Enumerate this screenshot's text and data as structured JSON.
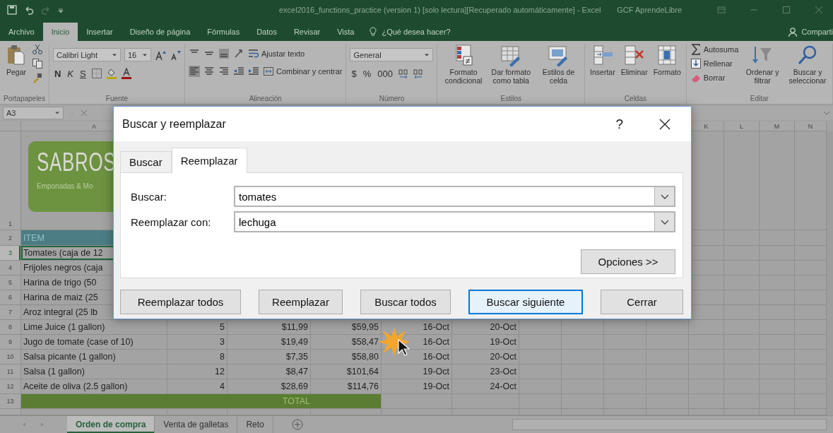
{
  "title_bar": {
    "title": "excel2016_functions_practice (version 1) [solo lectura][Recuperado automáticamente] - Excel",
    "user": "GCF AprendeLibre"
  },
  "menu_tabs": [
    {
      "label": "Archivo",
      "selected": false
    },
    {
      "label": "Inicio",
      "selected": true
    },
    {
      "label": "Insertar",
      "selected": false
    },
    {
      "label": "Diseño de página",
      "selected": false
    },
    {
      "label": "Fórmulas",
      "selected": false
    },
    {
      "label": "Datos",
      "selected": false
    },
    {
      "label": "Revisar",
      "selected": false
    },
    {
      "label": "Vista",
      "selected": false
    }
  ],
  "tell_me": "¿Qué desea hacer?",
  "share": "Comparti",
  "ribbon": [
    {
      "label": "Portapapeles",
      "kind": "columns",
      "lines": [
        [
          {
            "kind": "large",
            "text": "Pegar"
          }
        ],
        [
          {
            "kind": "icon"
          },
          {
            "kind": "icon"
          },
          {
            "kind": "icon"
          }
        ]
      ]
    },
    {
      "label": "Fuente",
      "kind": "rows",
      "lines": [
        [
          {
            "kind": "select",
            "text": "Calibri Light"
          },
          {
            "kind": "select",
            "text": "16"
          },
          {
            "kind": "icon"
          },
          {
            "kind": "icon"
          }
        ],
        [
          {
            "kind": "bold",
            "text": "N"
          },
          {
            "kind": "italic",
            "text": "K"
          },
          {
            "kind": "underline",
            "text": "S"
          },
          {
            "kind": "icon"
          },
          {
            "kind": "icon"
          },
          {
            "kind": "icon"
          }
        ]
      ]
    },
    {
      "label": "Alineación",
      "kind": "rows",
      "lines": [
        [
          {
            "kind": "icon"
          },
          {
            "kind": "icon"
          },
          {
            "kind": "icon"
          },
          {
            "kind": "icon"
          },
          {
            "kind": "small",
            "text": "Ajustar texto"
          }
        ],
        [
          {
            "kind": "icon"
          },
          {
            "kind": "icon"
          },
          {
            "kind": "icon"
          },
          {
            "kind": "icon"
          },
          {
            "kind": "icon"
          },
          {
            "kind": "small",
            "text": "Combinar y centrar"
          }
        ]
      ]
    },
    {
      "label": "Número",
      "kind": "rows",
      "lines": [
        [
          {
            "kind": "select",
            "text": "General"
          }
        ],
        [
          {
            "kind": "letter",
            "text": "$"
          },
          {
            "kind": "letter",
            "text": "%"
          },
          {
            "kind": "letter",
            "text": "000"
          },
          {
            "kind": "icon"
          },
          {
            "kind": "icon"
          }
        ]
      ]
    },
    {
      "label": "Estilos",
      "kind": "columns",
      "lines": [
        [
          {
            "kind": "large",
            "text": "Formato condicional"
          }
        ],
        [
          {
            "kind": "large",
            "text": "Dar formato como tabla"
          }
        ],
        [
          {
            "kind": "large",
            "text": "Estilos de celda"
          }
        ]
      ]
    },
    {
      "label": "Celdas",
      "kind": "columns",
      "lines": [
        [
          {
            "kind": "large",
            "text": "Insertar"
          }
        ],
        [
          {
            "kind": "large",
            "text": "Eliminar"
          }
        ],
        [
          {
            "kind": "large",
            "text": "Formato"
          }
        ]
      ]
    },
    {
      "label": "Editar",
      "kind": "columns",
      "lines": [
        [
          {
            "kind": "small",
            "text": "Autosuma"
          },
          {
            "kind": "small",
            "text": "Rellenar"
          },
          {
            "kind": "small",
            "text": "Borrar"
          }
        ],
        [
          {
            "kind": "large",
            "text": "Ordenar y filtrar"
          }
        ],
        [
          {
            "kind": "large",
            "text": "Buscar y seleccionar"
          }
        ]
      ]
    }
  ],
  "formula_bar": {
    "name_box": "A3"
  },
  "sheet": {
    "columns": [
      "A",
      "K",
      "L",
      "M",
      "N"
    ],
    "rows": [
      {
        "number": "1",
        "kind": "logo",
        "selected": false,
        "logo": {
          "title": "SABROS",
          "subtitle": "Emponadas & Mo"
        }
      },
      {
        "number": "2",
        "kind": "header",
        "selected": false,
        "cells": [
          "ITEM"
        ]
      },
      {
        "number": "3",
        "kind": "data",
        "selected": true,
        "cells": [
          "Tomates (caja de 12"
        ]
      },
      {
        "number": "4",
        "kind": "data",
        "selected": false,
        "cells": [
          "Frijoles negros (caja"
        ]
      },
      {
        "number": "5",
        "kind": "data",
        "selected": false,
        "cells": [
          "Harina de trigo (50"
        ]
      },
      {
        "number": "6",
        "kind": "data",
        "selected": false,
        "cells": [
          "Harina de maiz (25"
        ]
      },
      {
        "number": "7",
        "kind": "data",
        "selected": false,
        "cells": [
          "Aroz integral (25 lb"
        ]
      },
      {
        "number": "8",
        "kind": "data",
        "selected": false,
        "cells": [
          "Lime Juice (1 gallon)",
          "5",
          "$11,99",
          "$59,95",
          "16-Oct",
          "20-Oct"
        ]
      },
      {
        "number": "9",
        "kind": "data",
        "selected": false,
        "cells": [
          "Jugo de tomate (case of 10)",
          "3",
          "$19,49",
          "$58,47",
          "16-Oct",
          "19-Oct"
        ]
      },
      {
        "number": "10",
        "kind": "data",
        "selected": false,
        "cells": [
          "Salsa picante (1 gallon)",
          "8",
          "$7,35",
          "$58,80",
          "16-Oct",
          "20-Oct"
        ]
      },
      {
        "number": "11",
        "kind": "data",
        "selected": false,
        "cells": [
          "Salsa (1 gallon)",
          "12",
          "$8,47",
          "$101,64",
          "19-Oct",
          "23-Oct"
        ]
      },
      {
        "number": "12",
        "kind": "data",
        "selected": false,
        "cells": [
          "Aceite de oliva (2.5 gallon)",
          "4",
          "$28,69",
          "$114,76",
          "19-Oct",
          "24-Oct"
        ]
      },
      {
        "number": "13",
        "kind": "total",
        "selected": false,
        "cells": [
          "TOTAL"
        ]
      }
    ]
  },
  "sheet_tabs": [
    {
      "label": "Orden de compra",
      "selected": true
    },
    {
      "label": "Venta de galletas",
      "selected": false
    },
    {
      "label": "Reto",
      "selected": false
    }
  ],
  "dialog": {
    "title": "Buscar y reemplazar",
    "help": "?",
    "tabs": [
      {
        "label": "Buscar",
        "selected": false
      },
      {
        "label": "Reemplazar",
        "selected": true
      }
    ],
    "fields": [
      {
        "label": "Buscar:",
        "value": "tomates"
      },
      {
        "label": "Reemplazar con:",
        "value": "lechuga"
      }
    ],
    "options_button": "Opciones >>",
    "buttons": [
      {
        "label": "Reemplazar todos",
        "focused": false
      },
      {
        "label": "Reemplazar",
        "focused": false
      },
      {
        "label": "Buscar todos",
        "focused": false
      },
      {
        "label": "Buscar siguiente",
        "focused": true
      },
      {
        "label": "Cerrar",
        "focused": false
      }
    ]
  }
}
